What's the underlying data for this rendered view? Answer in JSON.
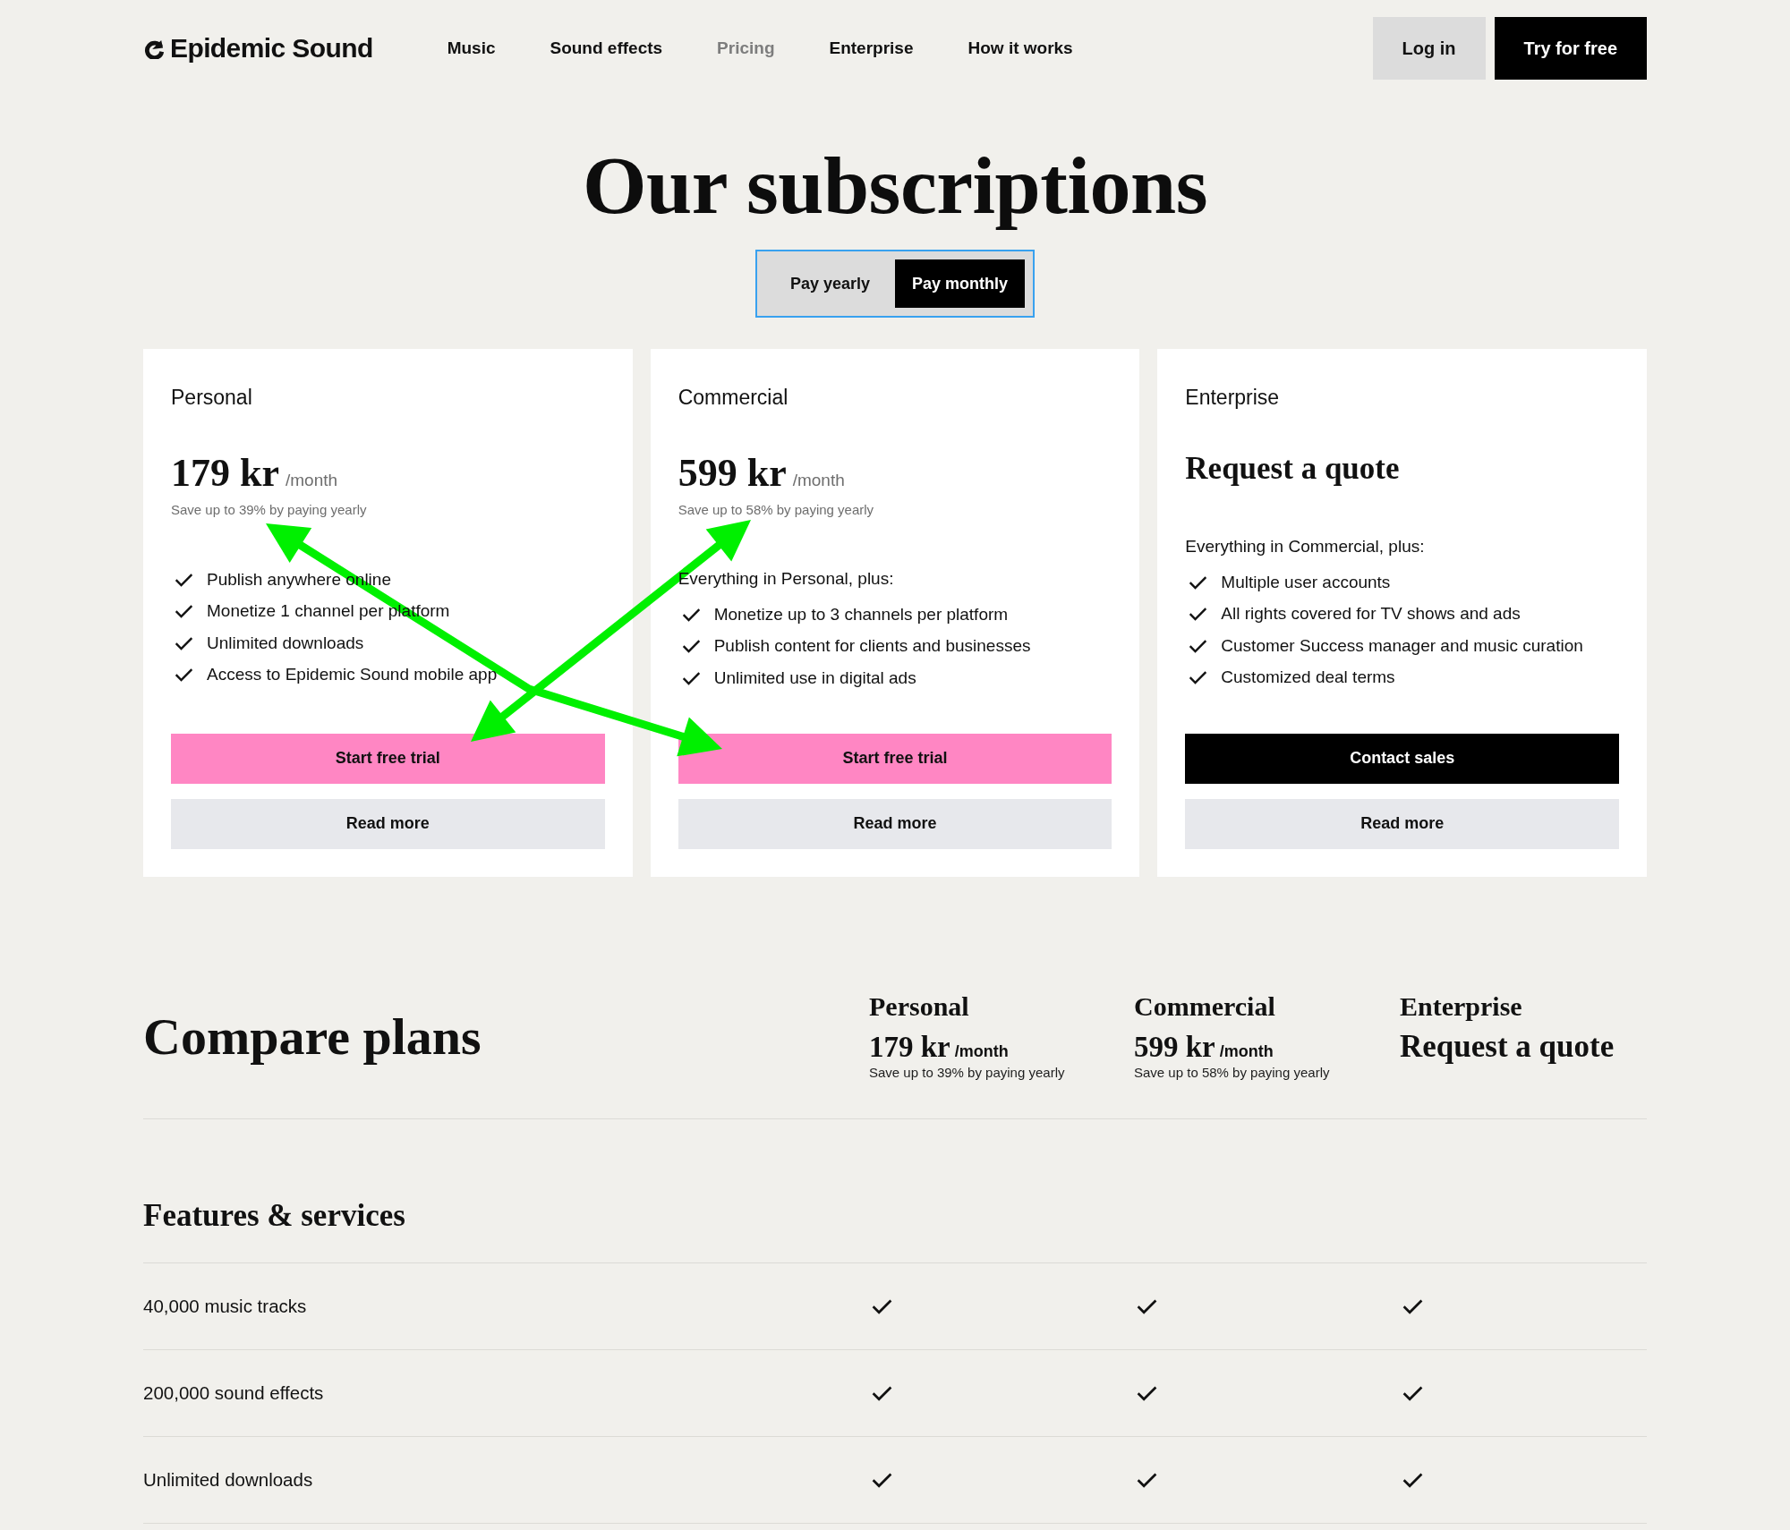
{
  "header": {
    "logo": "Epidemic Sound",
    "nav": [
      {
        "label": "Music",
        "selected": false
      },
      {
        "label": "Sound effects",
        "selected": false
      },
      {
        "label": "Pricing",
        "selected": true
      },
      {
        "label": "Enterprise",
        "selected": false
      },
      {
        "label": "How it works",
        "selected": false
      }
    ],
    "buttons": [
      {
        "label": "Log in",
        "kind": "secondary"
      },
      {
        "label": "Try for free",
        "kind": "primary"
      }
    ]
  },
  "hero": {
    "title": "Our subscriptions",
    "billing_toggle": [
      {
        "label": "Pay yearly",
        "selected": false
      },
      {
        "label": "Pay monthly",
        "selected": true
      }
    ]
  },
  "plans": [
    {
      "kind": "priced",
      "name": "Personal",
      "price": "179 kr",
      "period": "/month",
      "note": "Save up to 39% by paying yearly",
      "features": [
        "Publish anywhere online",
        "Monetize 1 channel per platform",
        "Unlimited downloads",
        "Access to Epidemic Sound mobile app"
      ],
      "buttons": [
        {
          "label": "Start free trial",
          "kind": "accent"
        },
        {
          "label": "Read more",
          "kind": "light"
        }
      ]
    },
    {
      "kind": "priced",
      "name": "Commercial",
      "price": "599 kr",
      "period": "/month",
      "note": "Save up to 58% by paying yearly",
      "features_intro": "Everything in Personal, plus:",
      "features": [
        "Monetize up to 3 channels per platform",
        "Publish content for clients and businesses",
        "Unlimited use in digital ads"
      ],
      "buttons": [
        {
          "label": "Start free trial",
          "kind": "accent"
        },
        {
          "label": "Read more",
          "kind": "light"
        }
      ]
    },
    {
      "kind": "quote",
      "name": "Enterprise",
      "quote": "Request a quote",
      "features_intro": "Everything in Commercial, plus:",
      "features": [
        "Multiple user accounts",
        "All rights covered for TV shows and ads",
        "Customer Success manager and music curation",
        "Customized deal terms"
      ],
      "buttons": [
        {
          "label": "Contact sales",
          "kind": "dark"
        },
        {
          "label": "Read more",
          "kind": "light"
        }
      ]
    }
  ],
  "compare": {
    "title": "Compare plans",
    "plans": [
      {
        "kind": "priced",
        "name": "Personal",
        "price": "179 kr",
        "period": "/month",
        "note": "Save up to 39% by paying yearly"
      },
      {
        "kind": "priced",
        "name": "Commercial",
        "price": "599 kr",
        "period": "/month",
        "note": "Save up to 58% by paying yearly"
      },
      {
        "kind": "quote",
        "name": "Enterprise",
        "quote": "Request a quote"
      }
    ],
    "sections": [
      {
        "title": "Features & services",
        "rows": [
          {
            "label": "40,000 music tracks",
            "cells": [
              {
                "included": true
              },
              {
                "included": true
              },
              {
                "included": true
              }
            ]
          },
          {
            "label": "200,000 sound effects",
            "cells": [
              {
                "included": true
              },
              {
                "included": true
              },
              {
                "included": true
              }
            ]
          },
          {
            "label": "Unlimited downloads",
            "cells": [
              {
                "included": true
              },
              {
                "included": true
              },
              {
                "included": true
              }
            ]
          }
        ]
      }
    ]
  }
}
